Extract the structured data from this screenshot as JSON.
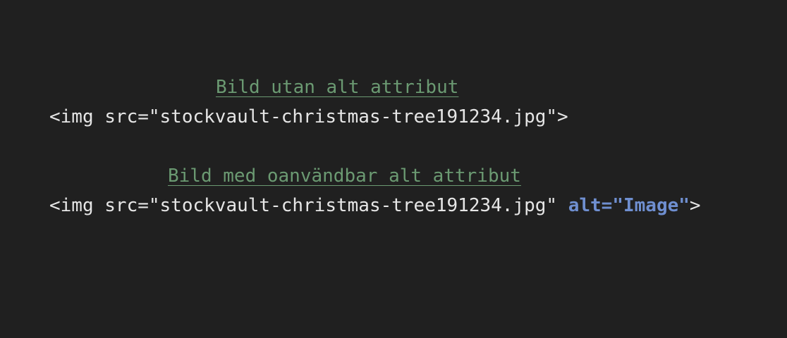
{
  "snippets": [
    {
      "caption": "Bild utan alt attribut",
      "code": "<img src=\"stockvault-christmas-tree191234.jpg\">"
    },
    {
      "caption": "Bild med oanvändbar alt attribut",
      "code_start": "<img src=\"stockvault-christmas-tree191234.jpg\" ",
      "code_attr": "alt=\"Image\"",
      "code_end": ">"
    }
  ],
  "colors": {
    "background": "#202020",
    "caption": "#6b9a72",
    "code_text": "#e6e6e6",
    "attribute_highlight": "#6f8fd0"
  }
}
